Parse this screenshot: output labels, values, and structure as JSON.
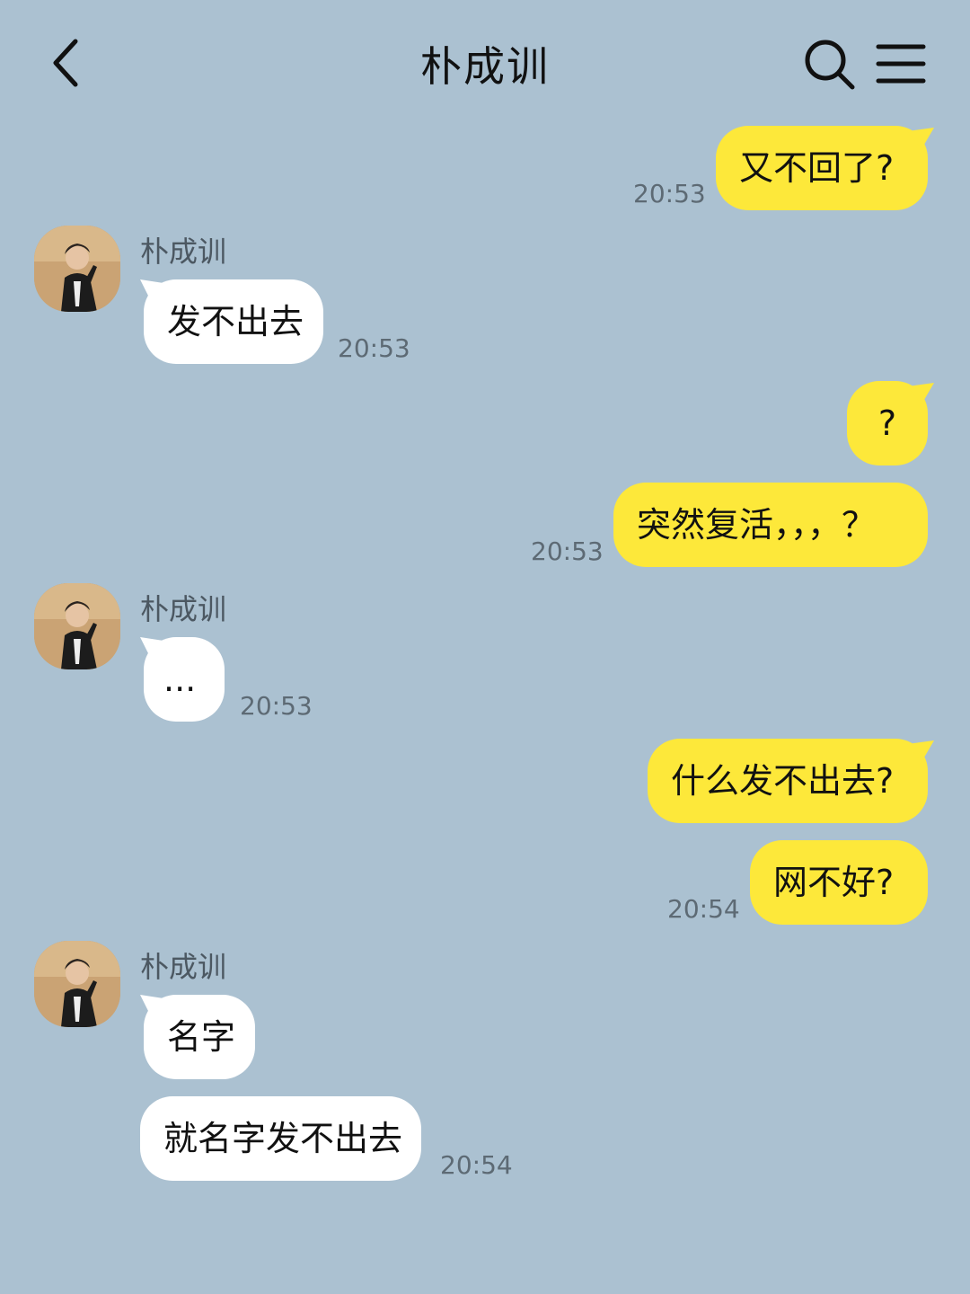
{
  "header": {
    "title": "朴成训"
  },
  "messages": [
    {
      "text": "又不回了?",
      "time": "20:53"
    },
    {
      "sender": "朴成训",
      "text": "发不出去",
      "time": "20:53"
    },
    {
      "text": "?"
    },
    {
      "text": "突然复活，，，？",
      "time": "20:53"
    },
    {
      "sender": "朴成训",
      "text": "...",
      "time": "20:53"
    },
    {
      "text": "什么发不出去?"
    },
    {
      "text": "网不好?",
      "time": "20:54"
    },
    {
      "sender": "朴成训",
      "text": "名字"
    },
    {
      "text": "就名字发不出去",
      "time": "20:54"
    }
  ],
  "colors": {
    "background": "#abc1d1",
    "my_bubble": "#fde83a",
    "their_bubble": "#ffffff"
  }
}
